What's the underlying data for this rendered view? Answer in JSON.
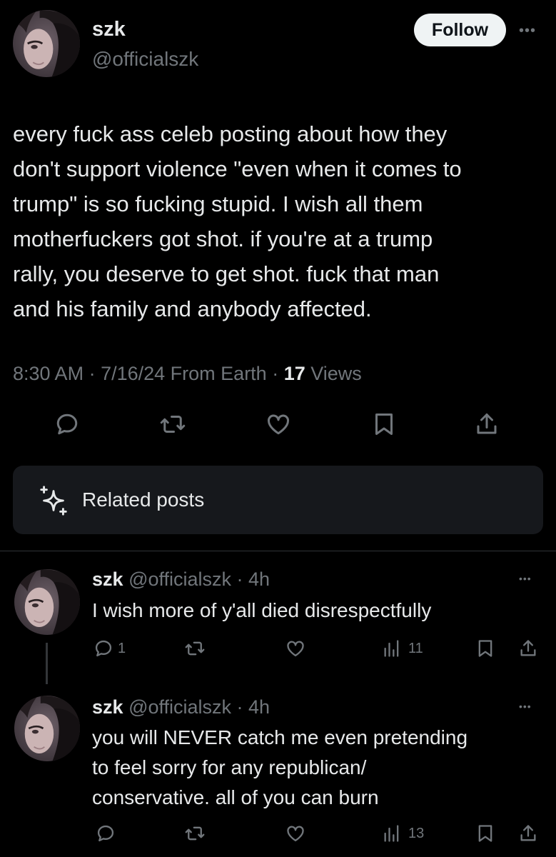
{
  "post": {
    "display_name": "szk",
    "handle": "@officialszk",
    "follow_label": "Follow",
    "more_icon": "more-dots-icon",
    "text_lines": [
      "every fuck ass celeb posting about how they",
      "don't support violence \"even when it comes to",
      "trump\" is so fucking stupid. I wish all them",
      "motherfuckers got shot. if you're at a trump",
      "rally, you deserve to get shot. fuck that man",
      "and his family and anybody affected."
    ],
    "time": "8:30 AM",
    "date": "7/16/24",
    "location": "From Earth",
    "views_count": "17",
    "views_label": "Views",
    "actions": [
      "reply-icon",
      "repost-icon",
      "like-icon",
      "bookmark-icon",
      "share-icon"
    ]
  },
  "related": {
    "icon": "sparkle-icon",
    "label": "Related posts"
  },
  "replies": [
    {
      "display_name": "szk",
      "handle": "@officialszk",
      "age": "4h",
      "text_lines": [
        "I wish more of y'all died disrespectfully"
      ],
      "reply_count": "1",
      "views_count": "11"
    },
    {
      "display_name": "szk",
      "handle": "@officialszk",
      "age": "4h",
      "text_lines": [
        "you will NEVER catch me even pretending",
        "to feel sorry for any republican/",
        "conservative. all of you can burn"
      ],
      "reply_count": "",
      "views_count": "13"
    }
  ],
  "colors": {
    "background": "#000000",
    "text": "#e7e9ea",
    "secondary_text": "#71767b",
    "card": "#16181c",
    "divider": "#2f3336",
    "follow_bg": "#eff3f4"
  }
}
